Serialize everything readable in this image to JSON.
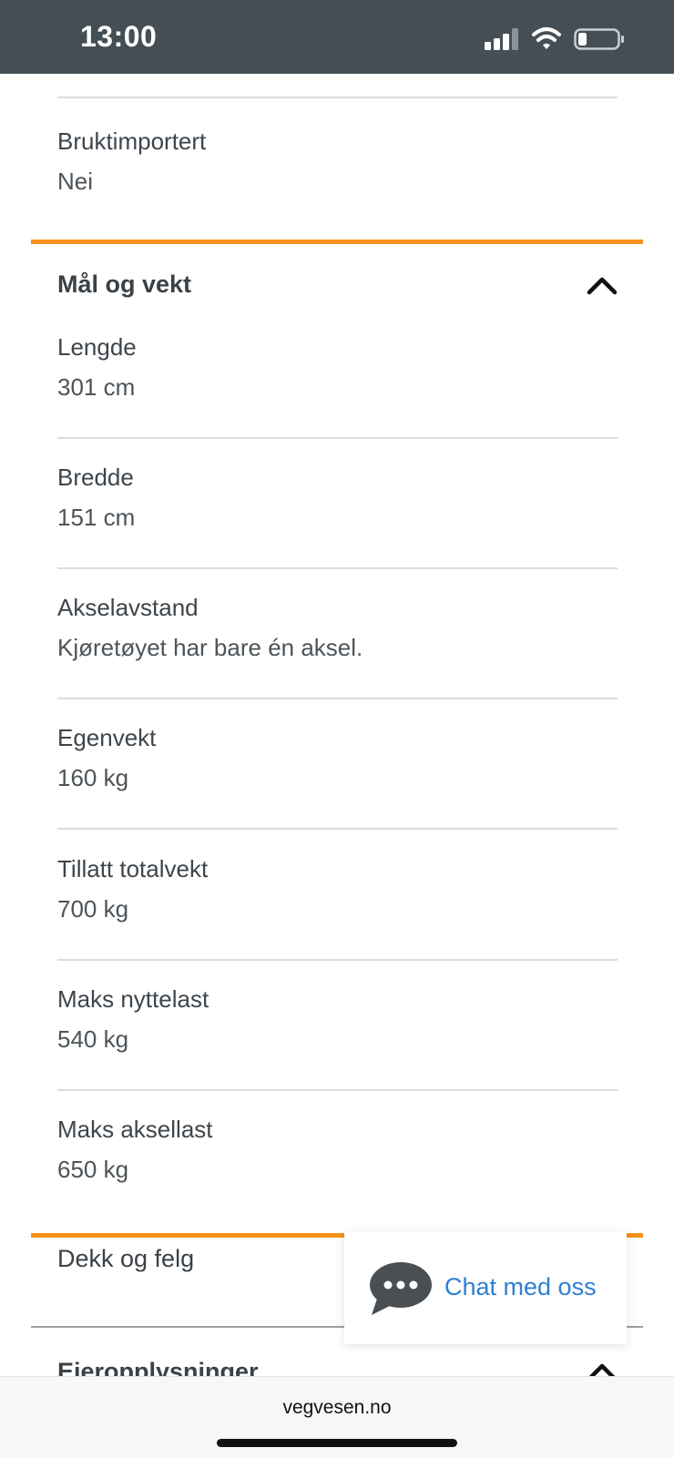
{
  "status": {
    "time": "13:00"
  },
  "sections": {
    "previous": {
      "fields": [
        {
          "label": "Bruktimportert",
          "value": "Nei"
        }
      ]
    },
    "mal_og_vekt": {
      "title": "Mål og vekt",
      "expanded": true,
      "fields": [
        {
          "label": "Lengde",
          "value": "301 cm"
        },
        {
          "label": "Bredde",
          "value": "151 cm"
        },
        {
          "label": "Akselavstand",
          "value": "Kjøretøyet har bare én aksel."
        },
        {
          "label": "Egenvekt",
          "value": "160 kg"
        },
        {
          "label": "Tillatt totalvekt",
          "value": "700 kg"
        },
        {
          "label": "Maks nyttelast",
          "value": "540 kg"
        },
        {
          "label": "Maks aksellast",
          "value": "650 kg"
        }
      ]
    },
    "dekk_og_felg": {
      "title": "Dekk og felg"
    },
    "eieropplysninger": {
      "title": "Eieropplysninger"
    }
  },
  "chat": {
    "label": "Chat med oss"
  },
  "browser": {
    "url": "vegvesen.no"
  },
  "colors": {
    "accent": "#f5921e",
    "status_bar": "#444f55",
    "link": "#2f7fd0"
  },
  "icons": [
    "signal-icon",
    "wifi-icon",
    "battery-icon",
    "chevron-up-icon",
    "chat-bubble-icon"
  ]
}
